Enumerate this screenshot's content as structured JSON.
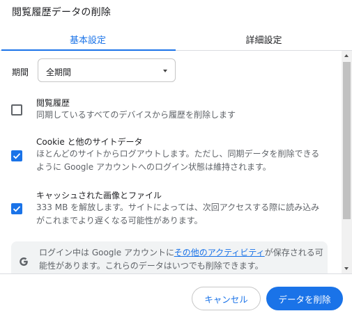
{
  "dialog": {
    "title": "閲覧履歴データの削除"
  },
  "tabs": [
    {
      "label": "基本設定",
      "selected": true
    },
    {
      "label": "詳細設定",
      "selected": false
    }
  ],
  "time_range": {
    "label": "期間",
    "selected_value": "全期間"
  },
  "options": [
    {
      "title": "閲覧履歴",
      "description": "同期しているすべてのデバイスから履歴を削除します",
      "checked": false
    },
    {
      "title": "Cookie と他のサイトデータ",
      "description": "ほとんどのサイトからログアウトします。ただし、同期データを削除できるように Google アカウントへのログイン状態は維持されます。",
      "checked": true
    },
    {
      "title": "キャッシュされた画像とファイル",
      "description": "333 MB を解放します。サイトによっては、次回アクセスする際に読み込みがこれまでより遅くなる可能性があります。",
      "checked": true
    }
  ],
  "info": {
    "text_before": "ログイン中は Google アカウントに",
    "link": "その他のアクティビティ",
    "text_after": "が保存される可能性があります。これらのデータはいつでも削除できます。"
  },
  "footer": {
    "cancel_label": "キャンセル",
    "delete_label": "データを削除"
  },
  "colors": {
    "accent": "#1a73e8",
    "text": "#202124",
    "secondary_text": "#5f6368",
    "info_background": "#f1f3f4"
  },
  "icons": {
    "google": "google-g-icon",
    "checkmark": "checkmark-icon",
    "dropdown": "chevron-down-icon"
  }
}
